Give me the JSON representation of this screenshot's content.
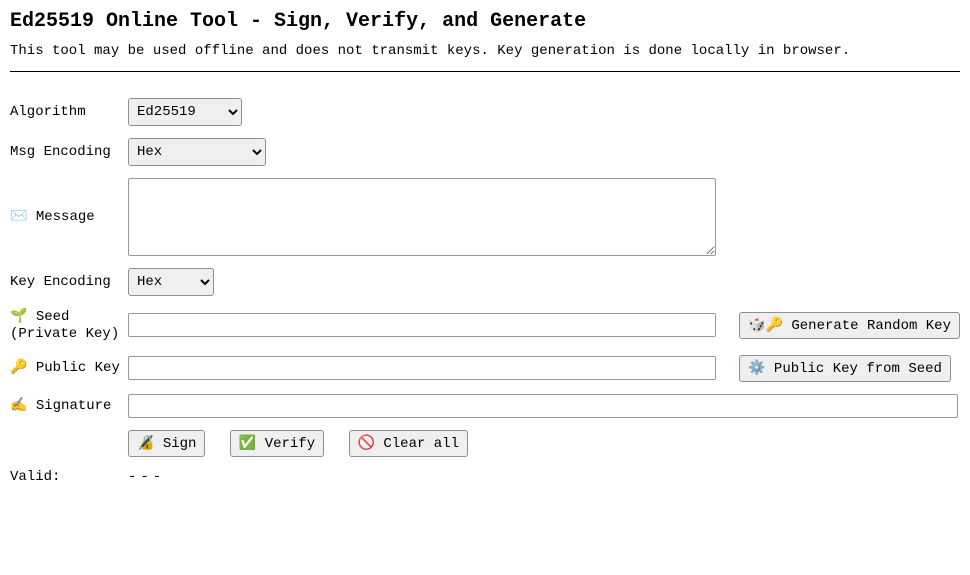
{
  "title": "Ed25519 Online Tool - Sign, Verify, and Generate",
  "subtitle": "This tool may be used offline and does not transmit keys. Key generation is done locally in browser.",
  "labels": {
    "algorithm": "Algorithm",
    "msg_encoding": "Msg Encoding",
    "message": "Message",
    "key_encoding": "Key Encoding",
    "seed": "Seed (Private Key)",
    "public_key": "Public Key",
    "signature": "Signature",
    "valid": "Valid:"
  },
  "icons": {
    "message": "✉️",
    "seed": "🌱",
    "public_key": "🔑",
    "signature": "✍️",
    "dice": "🎲",
    "key": "🔑",
    "gear": "⚙️",
    "lock": "🔏",
    "check": "✅",
    "no": "🚫"
  },
  "selects": {
    "algorithm": {
      "selected": "Ed25519",
      "options": [
        "Ed25519"
      ]
    },
    "msg_encoding": {
      "selected": "Hex",
      "options": [
        "Hex"
      ]
    },
    "key_encoding": {
      "selected": "Hex",
      "options": [
        "Hex"
      ]
    }
  },
  "inputs": {
    "message": "",
    "seed": "",
    "public_key": "",
    "signature": ""
  },
  "buttons": {
    "generate": "Generate Random Key",
    "derive_pub": "Public Key from Seed",
    "sign": "Sign",
    "verify": "Verify",
    "clear": "Clear all"
  },
  "results": {
    "valid": "---"
  }
}
